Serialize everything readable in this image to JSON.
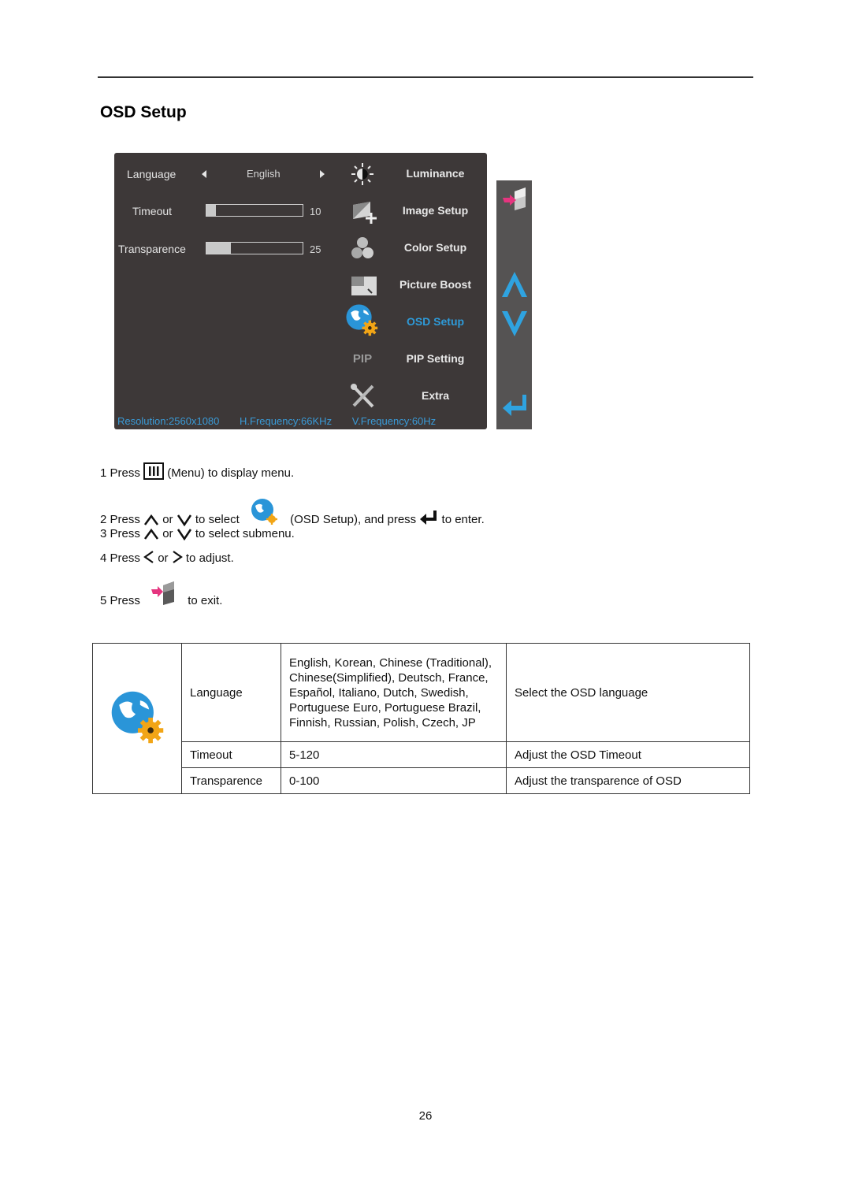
{
  "page": {
    "title": "OSD Setup",
    "page_number": "26"
  },
  "osd_panel": {
    "settings": [
      {
        "label": "Language",
        "value": "English"
      },
      {
        "label": "Timeout",
        "value": "10",
        "fill_percent": 10
      },
      {
        "label": "Transparence",
        "value": "25",
        "fill_percent": 25
      }
    ],
    "menu": [
      {
        "label": "Luminance",
        "icon": "luminance-icon",
        "active": false
      },
      {
        "label": "Image Setup",
        "icon": "image-setup-icon",
        "active": false
      },
      {
        "label": "Color Setup",
        "icon": "color-setup-icon",
        "active": false
      },
      {
        "label": "Picture Boost",
        "icon": "picture-boost-icon",
        "active": false
      },
      {
        "label": "OSD Setup",
        "icon": "osd-setup-icon",
        "active": true
      },
      {
        "label": "PIP Setting",
        "icon": "pip-icon",
        "icon_text": "PIP",
        "active": false
      },
      {
        "label": "Extra",
        "icon": "extra-tools-icon",
        "active": false
      }
    ],
    "status": {
      "resolution": "Resolution:2560x1080",
      "h_frequency": "H.Frequency:66KHz",
      "v_frequency": "V.Frequency:60Hz"
    },
    "colors": {
      "background": "#3d3838",
      "active_text": "#2e9ad8",
      "status_text": "#3a9ad6",
      "key_arrow": "#2fa3e0"
    }
  },
  "side_keys": [
    {
      "name": "exit-key",
      "icon": "exit-door-icon"
    },
    {
      "name": "up-key",
      "icon": "chevron-up-icon"
    },
    {
      "name": "down-key",
      "icon": "chevron-down-icon"
    },
    {
      "name": "enter-key",
      "icon": "enter-icon"
    }
  ],
  "instructions": {
    "step1": {
      "a": "1 Press",
      "b": "(Menu) to display menu."
    },
    "step2": {
      "a": "2 Press",
      "or": "or",
      "b": "to select",
      "c": "(OSD Setup), and press",
      "d": "to enter."
    },
    "step3": {
      "a": "3 Press",
      "or": "or",
      "b": "to select submenu."
    },
    "step4": {
      "a": "4 Press",
      "or": "or",
      "b": "to adjust."
    },
    "step5": {
      "a": "5 Press",
      "b": "to exit."
    }
  },
  "table": {
    "rows": [
      {
        "item": "Language",
        "range": "English, Korean, Chinese (Traditional), Chinese(Simplified), Deutsch, France, Español, Italiano, Dutch, Swedish, Portuguese Euro, Portuguese Brazil, Finnish, Russian, Polish, Czech, JP",
        "description": "Select the OSD language"
      },
      {
        "item": "Timeout",
        "range": "5-120",
        "description": "Adjust the OSD Timeout"
      },
      {
        "item": "Transparence",
        "range": "0-100",
        "description": "Adjust the transparence of OSD"
      }
    ]
  }
}
